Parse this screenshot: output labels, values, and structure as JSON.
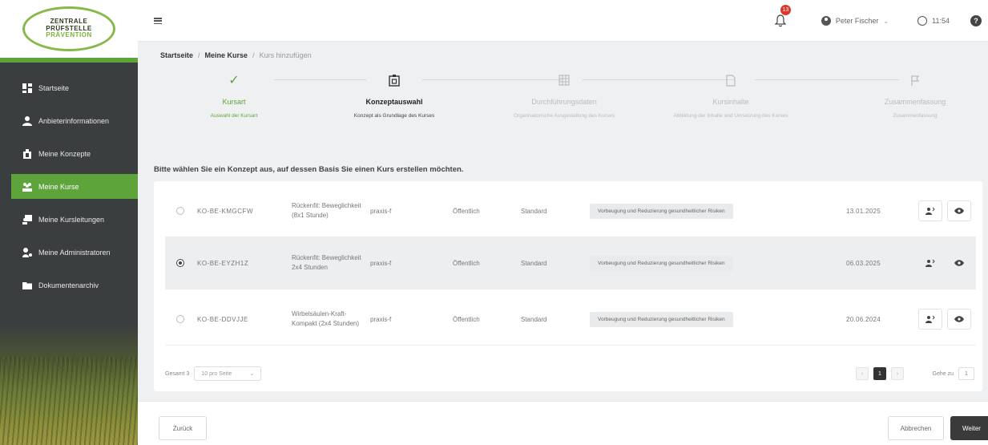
{
  "logo": {
    "line1": "ZENTRALE",
    "line2": "PRÜFSTELLE",
    "line3": "PRÄVENTION"
  },
  "sidebar": {
    "items": [
      {
        "label": "Startseite",
        "icon": "dashboard-icon",
        "active": false
      },
      {
        "label": "Anbieterinformationen",
        "icon": "person-icon",
        "active": false
      },
      {
        "label": "Meine Konzepte",
        "icon": "concept-icon",
        "active": false
      },
      {
        "label": "Meine Kurse",
        "icon": "group-icon",
        "active": true
      },
      {
        "label": "Meine Kursleitungen",
        "icon": "instructor-icon",
        "active": false
      },
      {
        "label": "Meine Administratoren",
        "icon": "admin-icon",
        "active": false
      },
      {
        "label": "Dokumentenarchiv",
        "icon": "folder-icon",
        "active": false
      }
    ]
  },
  "topbar": {
    "notification_count": "13",
    "user_name": "Peter Fischer",
    "timer": "11:54"
  },
  "breadcrumb": {
    "home": "Startseite",
    "section": "Meine Kurse",
    "current": "Kurs hinzufügen"
  },
  "stepper": [
    {
      "title": "Kursart",
      "sub": "Auswahl der Kursart",
      "state": "done"
    },
    {
      "title": "Konzeptauswahl",
      "sub": "Konzept als Grundlage des Kurses",
      "state": "active"
    },
    {
      "title": "Durchführungsdaten",
      "sub": "Organisatorische Ausgestaltung des Kurses",
      "state": "todo"
    },
    {
      "title": "Kursinhalte",
      "sub": "Abbildung der Inhalte und Umsetzung des Kurses",
      "state": "todo"
    },
    {
      "title": "Zusammenfassung",
      "sub": "Zusammenfassung",
      "state": "todo"
    }
  ],
  "intro": "Bitte wählen Sie ein Konzept aus, auf dessen Basis Sie einen Kurs erstellen möchten.",
  "table": {
    "rows": [
      {
        "id": "KO-BE-KMGCFW",
        "name": "Rückenfit: Beweglichkeit (8x1 Stunde)",
        "user": "praxis-f",
        "visibility": "Öffentlich",
        "type": "Standard",
        "tag": "Vorbeugung und Reduzierung gesundheitlicher Risiken",
        "date": "13.01.2025",
        "selected": false
      },
      {
        "id": "KO-BE-EYZH1Z",
        "name": "Rückenfit: Beweglichkeit 2x4 Stunden",
        "user": "praxis-f",
        "visibility": "Öffentlich",
        "type": "Standard",
        "tag": "Vorbeugung und Reduzierung gesundheitlicher Risiken",
        "date": "06.03.2025",
        "selected": true
      },
      {
        "id": "KO-BE-DDVJJE",
        "name": "Wirbelsäulen-Kraft-Kompakt (2x4 Stunden)",
        "user": "praxis-f",
        "visibility": "Öffentlich",
        "type": "Standard",
        "tag": "Vorbeugung und Reduzierung gesundheitlicher Risiken",
        "date": "20.06.2024",
        "selected": false
      }
    ],
    "total_label": "Gesamt 3",
    "per_page": "10 pro Seite",
    "current_page": "1",
    "goto_label": "Gehe zu",
    "goto_value": "1"
  },
  "footer": {
    "back": "Zurück",
    "cancel": "Abbrechen",
    "next": "Weiter"
  }
}
